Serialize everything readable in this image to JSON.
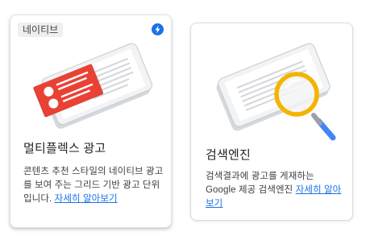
{
  "cards": [
    {
      "badge": "네이티브",
      "title": "멀티플렉스 광고",
      "description": "콘텐츠 추천 스타일의 네이티브 광고를 보여 주는 그리드 기반 광고 단위입니다.",
      "learn_more": "자세히 알아보기",
      "icon": "bolt-icon",
      "accent_color": "#1a73e8"
    },
    {
      "title": "검색엔진",
      "description": "검색결과에 광고를 게재하는 Google 제공 검색엔진",
      "learn_more": "자세히 알아보기",
      "accent_color": "#f4b400"
    }
  ]
}
